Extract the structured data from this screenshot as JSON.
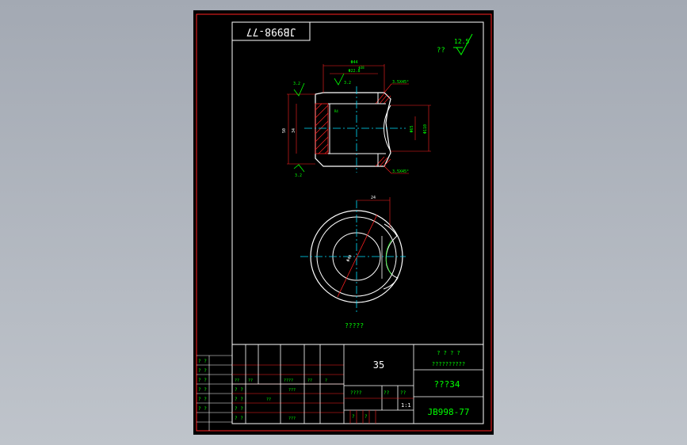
{
  "title_box_text": "JB998-77",
  "roughness_note": {
    "prefix": "??",
    "value": "12.5"
  },
  "section_view": {
    "dims": {
      "top_outer": "Φ44",
      "top_inner1": "Φ38",
      "top_inner2": "Φ22.8",
      "chamfer_top": "3.5X45°",
      "chamfer_bottom": "3.5X45°",
      "left_height": "50",
      "left_inner": "34",
      "right_outer": "Φ110",
      "right_inner": "Φ65",
      "roughness_top": "3.2",
      "roughness_bottom": "3.2",
      "small_label": "R4"
    }
  },
  "plan_view": {
    "dim_top": "24",
    "dia_label": "Φ40"
  },
  "note_text": "?????",
  "title_block": {
    "material": "35",
    "company_line1": "? ? ? ?",
    "company_line2": "??????????",
    "part_name": "???34",
    "drawing_number": "JB998-77",
    "scale_header": "????",
    "weight_header": "??",
    "scale_col": "??",
    "scale_value": "1:1",
    "sheet_label1": "?",
    "sheet_label2": "?",
    "left_labels": [
      "? ?",
      "? ?",
      "? ?",
      "? ?",
      "? ?",
      "? ?"
    ],
    "sign_labels": [
      "? ?",
      "? ?",
      "? ?",
      "? ?",
      "? ?"
    ],
    "row_labels": [
      "??",
      "??",
      "????",
      "??",
      "?"
    ],
    "row_labels2": [
      "???",
      "???",
      "??"
    ]
  }
}
